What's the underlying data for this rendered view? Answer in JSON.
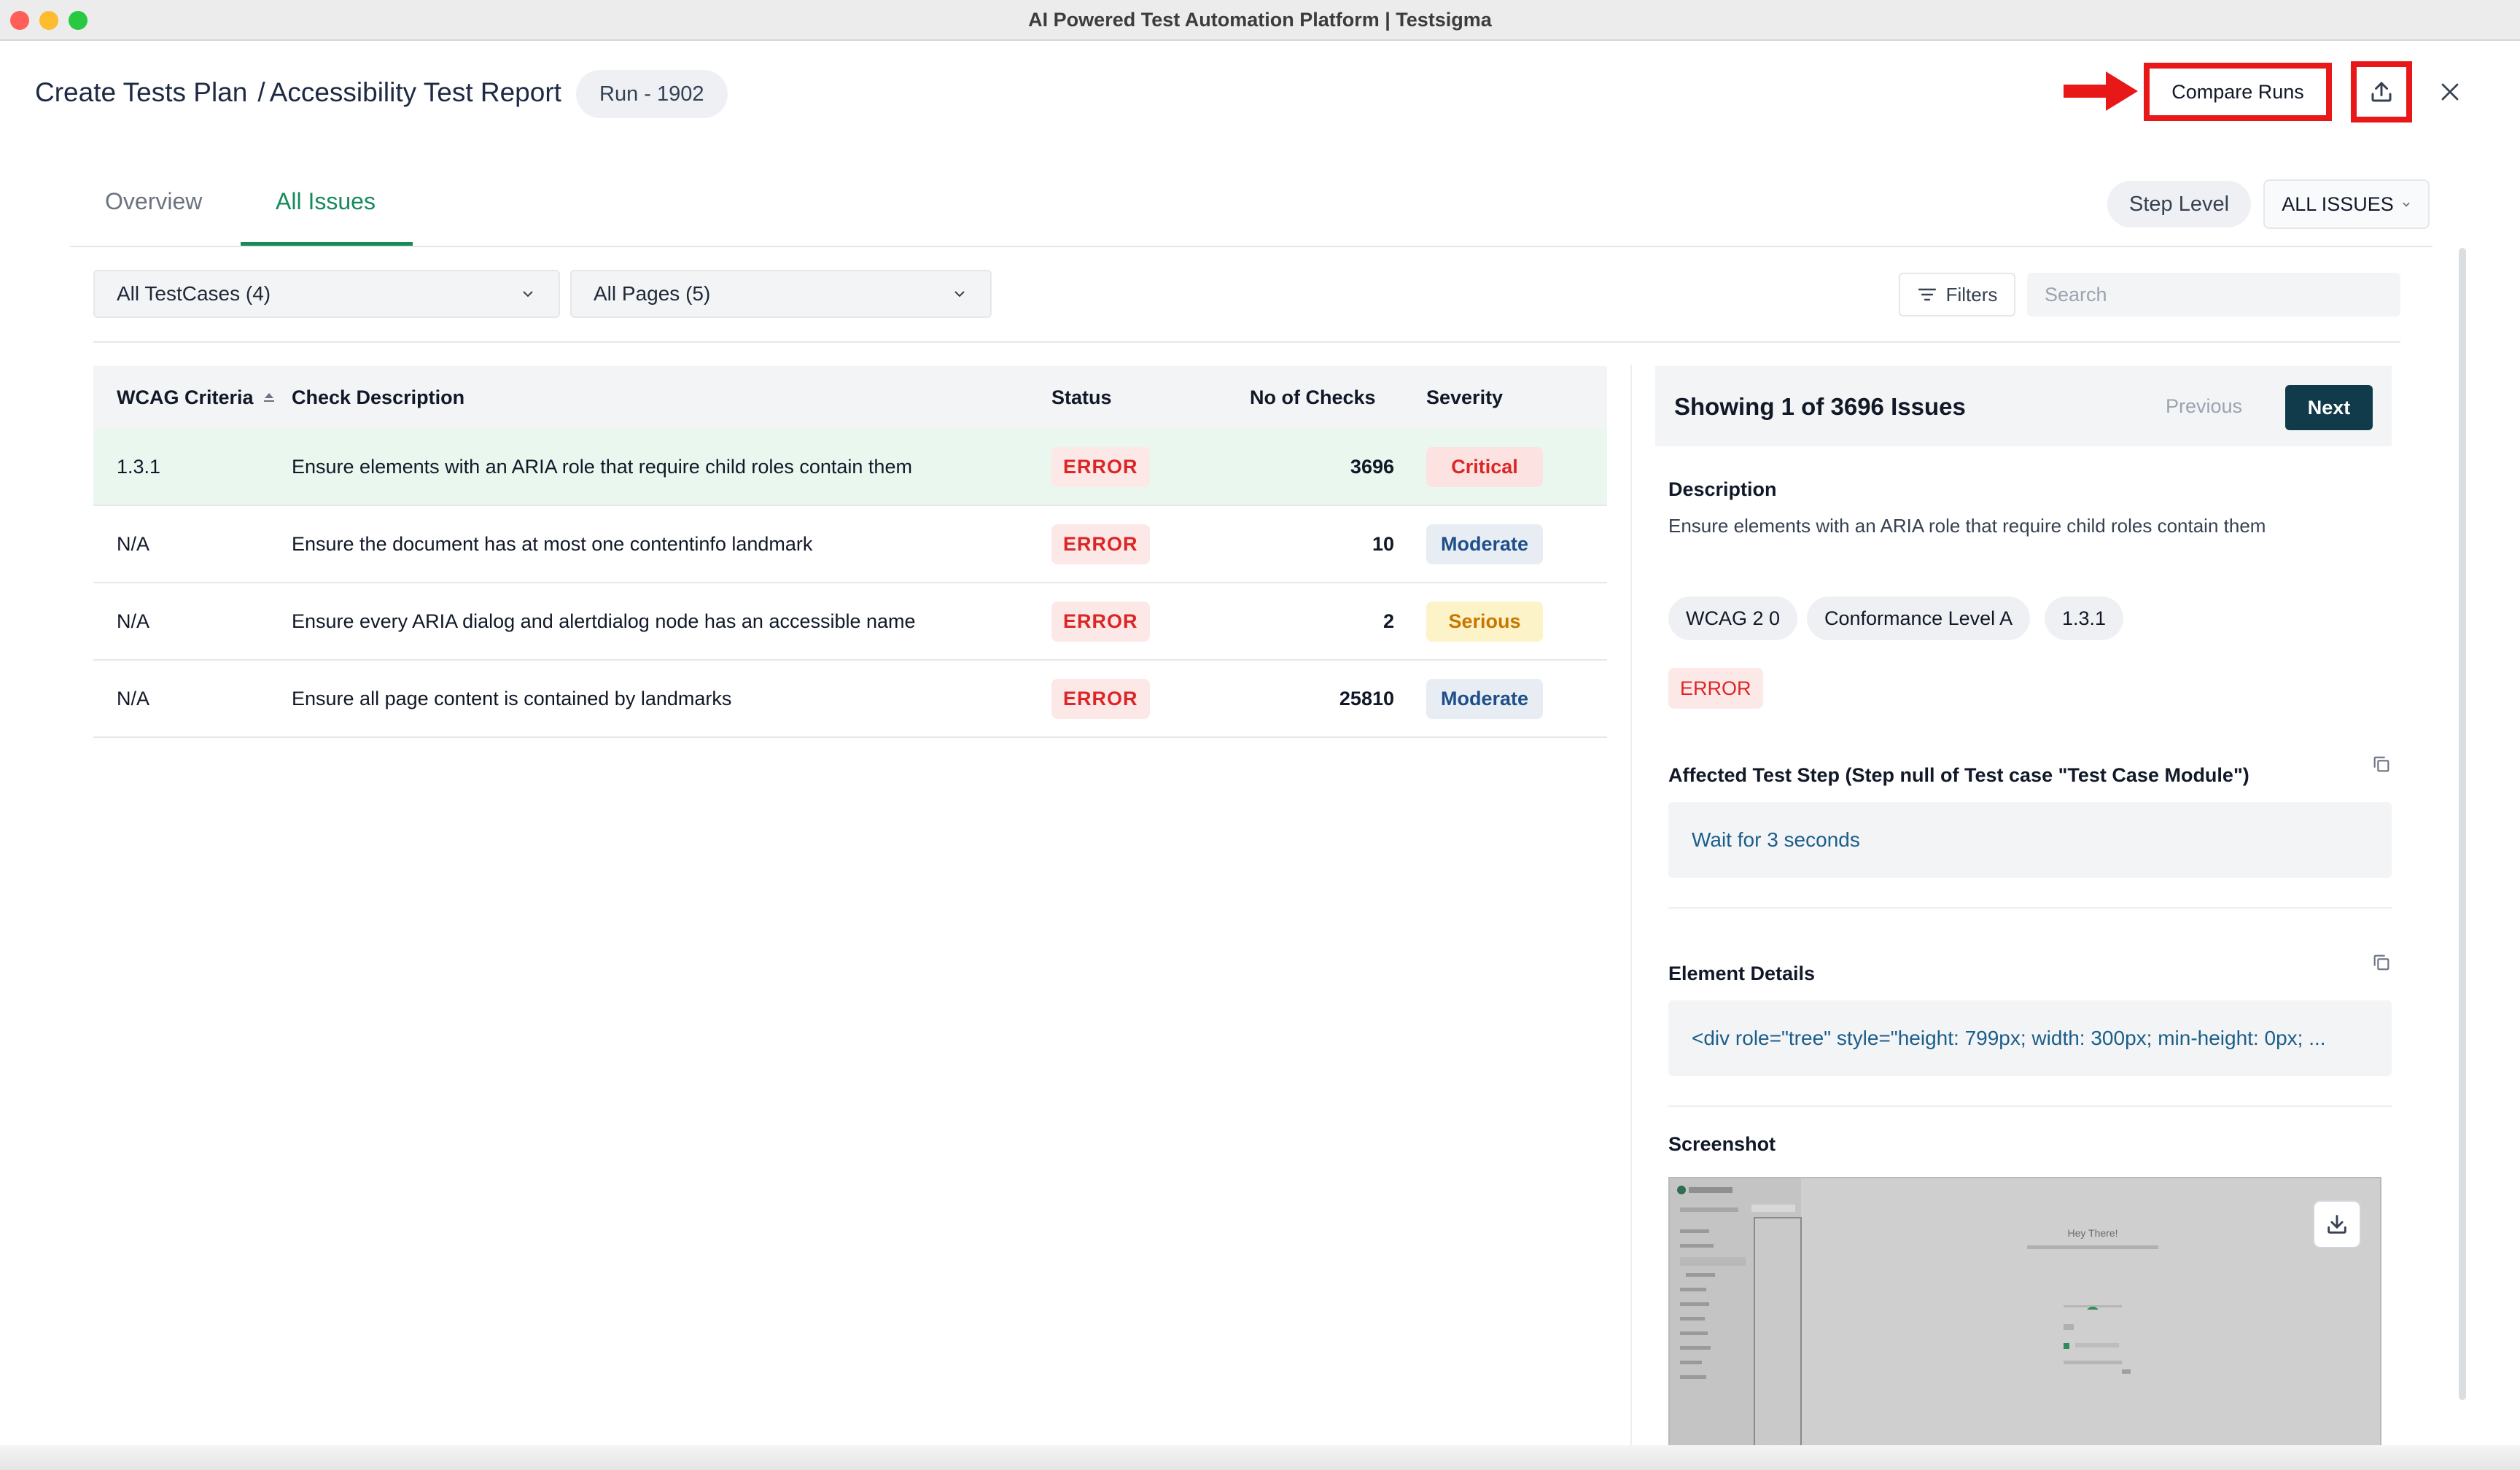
{
  "window": {
    "title": "AI Powered Test Automation Platform | Testsigma"
  },
  "header": {
    "breadcrumb_parent": "Create Tests Plan",
    "breadcrumb_separator": "/",
    "breadcrumb_current": "Accessibility Test Report",
    "run_label": "Run - 1902",
    "compare_runs_label": "Compare Runs",
    "export_icon": "upload-icon",
    "close_icon": "close-icon"
  },
  "tabs": [
    {
      "label": "Overview",
      "active": false
    },
    {
      "label": "All Issues",
      "active": true
    }
  ],
  "toolbar": {
    "step_level_label": "Step Level",
    "issues_dropdown_label": "ALL ISSUES",
    "testcases_select": "All TestCases (4)",
    "pages_select": "All Pages (5)",
    "filters_label": "Filters",
    "search_placeholder": "Search"
  },
  "table": {
    "headers": {
      "wcag": "WCAG Criteria",
      "description": "Check Description",
      "status": "Status",
      "checks": "No of Checks",
      "severity": "Severity"
    },
    "rows": [
      {
        "wcag": "1.3.1",
        "description": "Ensure elements with an ARIA role that require child roles contain them",
        "status": "ERROR",
        "checks": "3696",
        "severity": "Critical"
      },
      {
        "wcag": "N/A",
        "description": "Ensure the document has at most one contentinfo landmark",
        "status": "ERROR",
        "checks": "10",
        "severity": "Moderate"
      },
      {
        "wcag": "N/A",
        "description": "Ensure every ARIA dialog and alertdialog node has an accessible name",
        "status": "ERROR",
        "checks": "2",
        "severity": "Serious"
      },
      {
        "wcag": "N/A",
        "description": "Ensure all page content is contained by landmarks",
        "status": "ERROR",
        "checks": "25810",
        "severity": "Moderate"
      }
    ]
  },
  "severity_colors": {
    "Critical": {
      "bg": "#fde2e2",
      "fg": "#dc2626"
    },
    "Moderate": {
      "bg": "#e8edf3",
      "fg": "#1e4f8a"
    },
    "Serious": {
      "bg": "#fdf3c8",
      "fg": "#c77700"
    }
  },
  "detail": {
    "showing": "Showing 1 of 3696 Issues",
    "previous_label": "Previous",
    "next_label": "Next",
    "description_label": "Description",
    "description": "Ensure elements with an ARIA role that require child roles contain them",
    "chips": [
      "WCAG 2 0",
      "Conformance Level A",
      "1.3.1"
    ],
    "status": "ERROR",
    "affected_step_label": "Affected Test Step (Step null of Test case \"Test Case Module\")",
    "affected_step": "Wait for 3 seconds",
    "element_details_label": "Element Details",
    "element_details": "<div role=\"tree\" style=\"height: 799px; width: 300px; min-height: 0px; ...",
    "screenshot_label": "Screenshot",
    "screenshot_greeting": "Hey There!",
    "screenshot_logo": "testsigma"
  },
  "colors": {
    "accent_green": "#178a5c",
    "next_button": "#113b4a",
    "highlight_red": "#e81818",
    "error_red": "#dc2626"
  }
}
